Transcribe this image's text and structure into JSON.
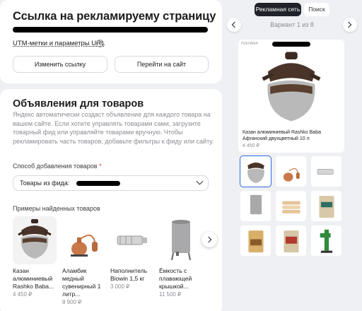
{
  "link_section": {
    "title": "Ссылка на рекламируему страницу",
    "utm_label": "UTM-метки и параметры URL",
    "help_glyph": "?",
    "change_link_button": "Изменить ссылку",
    "go_to_site_button": "Перейти на сайт"
  },
  "product_ads": {
    "title": "Объявления для товаров",
    "description": "Яндекс автоматически создаст объявление для каждого товара на вашем сайте. Если хотите управлять товарами сами, загрузите товарный фид или управляйте товарами вручную. Чтобы рекламировать часть товаров, добавьте фильтры к фиду или сайту.",
    "method_label": "Способ добавления товаров",
    "required_mark": "*",
    "method_value": "Товары из фида:",
    "examples_label": "Примеры найденных товаров",
    "products": [
      {
        "name": "Казан алюминиевый Rashko Baba...",
        "price": "4 450 ₽",
        "icon": "kazan-icon"
      },
      {
        "name": "Аламбик медный сувенирный 1 литр...",
        "price": "8 900 ₽",
        "icon": "alembic-icon"
      },
      {
        "name": "Наполнитель Biowin 1,5 кг",
        "price": "3 000 ₽",
        "icon": "filler-icon"
      },
      {
        "name": "Ёмкость с плавающей крышкой...",
        "price": "11 500 ₽",
        "icon": "tank-icon"
      }
    ]
  },
  "preview": {
    "tabs": [
      "Рекламная сеть",
      "Поиск"
    ],
    "active_tab": "Рекламная сеть",
    "variant_text": "Вариант 1 из 8",
    "ad_label": "РЕКЛАМА",
    "ad_title": "Казан алюминиевый Rashko Baba Афганский двухцветный 10 л",
    "ad_price": "4 450 ₽",
    "thumbnails": [
      "kazan-icon",
      "alembic-icon",
      "filler-icon",
      "tank-icon",
      "bags-icon",
      "package-icon",
      "spice-icon",
      "spice-red-icon",
      "machine-icon"
    ]
  },
  "colors": {
    "accent": "#2d6bdf",
    "tab_active": "#1f2229",
    "background": "#eef0f3",
    "required": "#e53935"
  }
}
